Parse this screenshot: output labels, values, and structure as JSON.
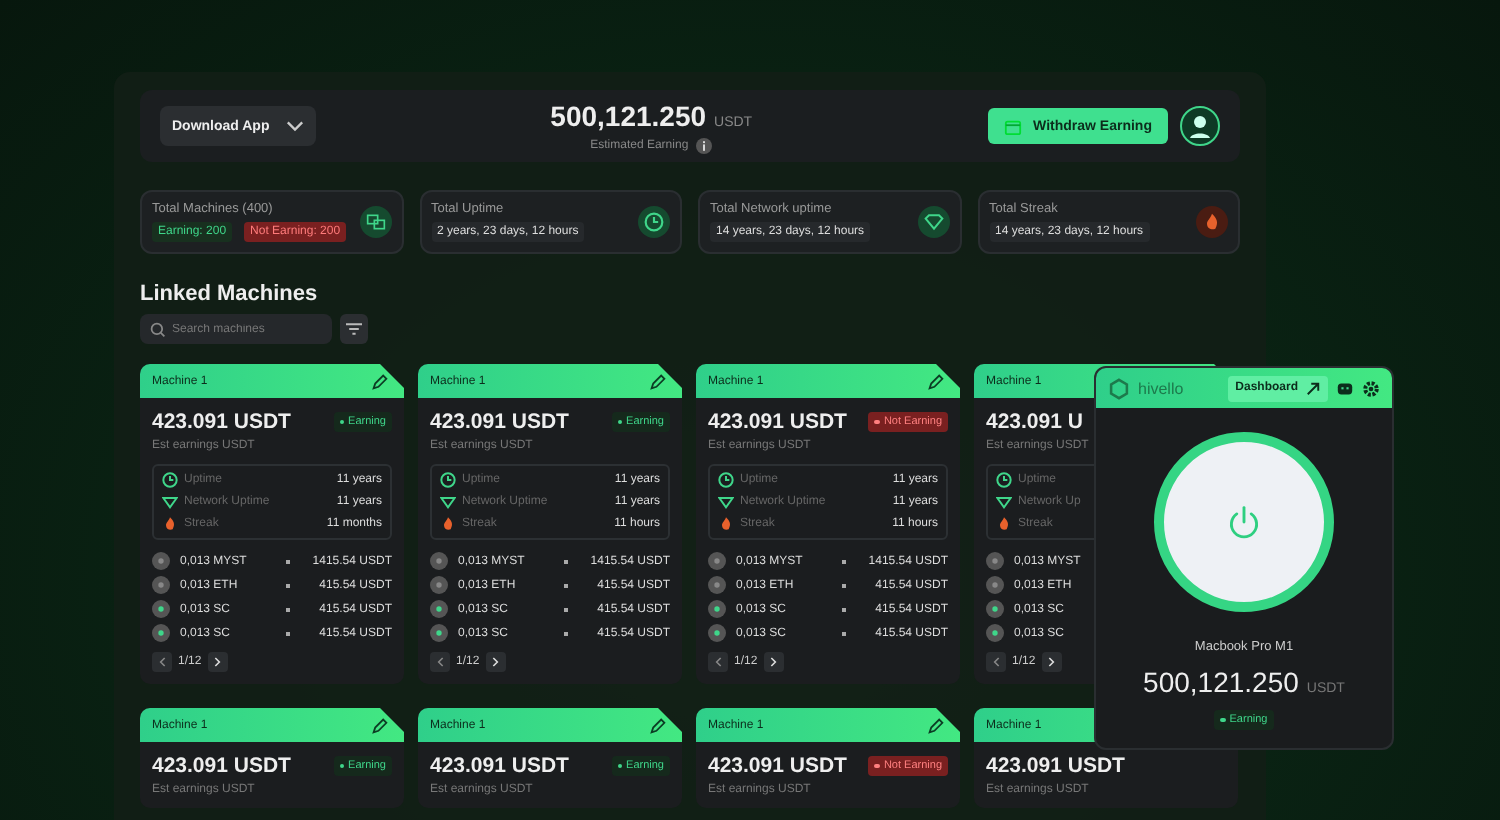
{
  "header": {
    "download_label": "Download App",
    "balance": "500,121.250",
    "balance_unit": "USDT",
    "balance_caption": "Estimated Earning",
    "withdraw_label": "Withdraw Earning"
  },
  "stats": [
    {
      "kind": "split",
      "label": "Total Machines (400)",
      "earning": "Earning: 200",
      "not_earning": "Not Earning: 200"
    },
    {
      "kind": "text",
      "label": "Total Uptime",
      "value": "2 years, 23 days, 12 hours"
    },
    {
      "kind": "text",
      "label": "Total Network uptime",
      "value": "14 years, 23 days, 12 hours"
    },
    {
      "kind": "text",
      "label": "Total Streak",
      "value": "14 years, 23 days, 12 hours"
    }
  ],
  "section_title": "Linked Machines",
  "search": {
    "placeholder": "Search machines"
  },
  "machines": [
    {
      "name": "Machine 1",
      "amount": "423.091 USDT",
      "status": "Earning",
      "earning": true,
      "caption": "Est earnings USDT",
      "stats": [
        {
          "label": "Uptime",
          "value": "11 years"
        },
        {
          "label": "Network Uptime",
          "value": "11 years"
        },
        {
          "label": "Streak",
          "value": "11 months"
        }
      ],
      "coins": [
        {
          "amount": "0,013 MYST",
          "value": "1415.54 USDT"
        },
        {
          "amount": "0,013 ETH",
          "value": "415.54 USDT"
        },
        {
          "amount": "0,013 SC",
          "value": "415.54 USDT"
        },
        {
          "amount": "0,013 SC",
          "value": "415.54 USDT"
        }
      ],
      "page": "1/12"
    },
    {
      "name": "Machine 1",
      "amount": "423.091 USDT",
      "status": "Earning",
      "earning": true,
      "caption": "Est earnings USDT",
      "stats": [
        {
          "label": "Uptime",
          "value": "11 years"
        },
        {
          "label": "Network Uptime",
          "value": "11 years"
        },
        {
          "label": "Streak",
          "value": "11 hours"
        }
      ],
      "coins": [
        {
          "amount": "0,013 MYST",
          "value": "1415.54 USDT"
        },
        {
          "amount": "0,013 ETH",
          "value": "415.54 USDT"
        },
        {
          "amount": "0,013 SC",
          "value": "415.54 USDT"
        },
        {
          "amount": "0,013 SC",
          "value": "415.54 USDT"
        }
      ],
      "page": "1/12"
    },
    {
      "name": "Machine 1",
      "amount": "423.091 USDT",
      "status": "Not Earning",
      "earning": false,
      "caption": "Est earnings USDT",
      "stats": [
        {
          "label": "Uptime",
          "value": "11 years"
        },
        {
          "label": "Network Uptime",
          "value": "11 years"
        },
        {
          "label": "Streak",
          "value": "11 hours"
        }
      ],
      "coins": [
        {
          "amount": "0,013 MYST",
          "value": "1415.54 USDT"
        },
        {
          "amount": "0,013 ETH",
          "value": "415.54 USDT"
        },
        {
          "amount": "0,013 SC",
          "value": "415.54 USDT"
        },
        {
          "amount": "0,013 SC",
          "value": "415.54 USDT"
        }
      ],
      "page": "1/12"
    },
    {
      "name": "Machine 1",
      "amount": "423.091 U",
      "caption": "Est earnings USDT",
      "stats": [
        {
          "label": "Uptime"
        },
        {
          "label": "Network Up"
        },
        {
          "label": "Streak"
        }
      ],
      "coins": [
        {
          "amount": "0,013 MYST"
        },
        {
          "amount": "0,013 ETH"
        },
        {
          "amount": "0,013 SC"
        },
        {
          "amount": "0,013 SC"
        }
      ],
      "page": "1/12"
    },
    {
      "name": "Machine 1",
      "amount": "423.091 USDT",
      "status": "Earning",
      "earning": true,
      "caption": "Est earnings USDT"
    },
    {
      "name": "Machine 1",
      "amount": "423.091 USDT",
      "status": "Earning",
      "earning": true,
      "caption": "Est earnings USDT"
    },
    {
      "name": "Machine 1",
      "amount": "423.091 USDT",
      "status": "Not Earning",
      "earning": false,
      "caption": "Est earnings USDT"
    },
    {
      "name": "Machine 1",
      "amount": "423.091 USDT",
      "caption": "Est earnings USDT"
    }
  ],
  "widget": {
    "brand": "hivello",
    "dashboard_label": "Dashboard",
    "device": "Macbook Pro M1",
    "balance": "500,121.250",
    "balance_unit": "USDT",
    "status": "Earning",
    "earning": true
  }
}
